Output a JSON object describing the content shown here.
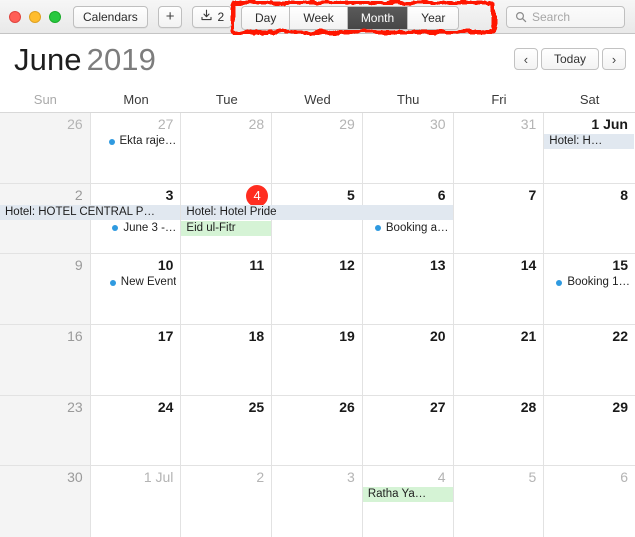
{
  "window": {
    "traffic_lights": [
      "close",
      "minimize",
      "zoom"
    ]
  },
  "toolbar": {
    "calendars_label": "Calendars",
    "add_label": "+",
    "inbox_icon": "download-tray-icon",
    "inbox_count": "2",
    "views": [
      {
        "label": "Day",
        "active": false
      },
      {
        "label": "Week",
        "active": false
      },
      {
        "label": "Month",
        "active": true
      },
      {
        "label": "Year",
        "active": false
      }
    ],
    "search": {
      "icon": "search-icon",
      "placeholder": "Search",
      "value": ""
    },
    "annotation": {
      "color": "#ff1200",
      "target": "view-switcher"
    }
  },
  "header": {
    "month": "June",
    "year": "2019",
    "prev_label": "‹",
    "today_label": "Today",
    "next_label": "›"
  },
  "weekdays": [
    {
      "label": "Sun",
      "muted": true
    },
    {
      "label": "Mon",
      "muted": false
    },
    {
      "label": "Tue",
      "muted": false
    },
    {
      "label": "Wed",
      "muted": false
    },
    {
      "label": "Thu",
      "muted": false
    },
    {
      "label": "Fri",
      "muted": false
    },
    {
      "label": "Sat",
      "muted": false
    }
  ],
  "grid": {
    "weeks": [
      [
        {
          "num": "26",
          "other": true,
          "weekend": true,
          "today": false,
          "bold": false
        },
        {
          "num": "27",
          "other": true,
          "weekend": false,
          "today": false,
          "bold": false
        },
        {
          "num": "28",
          "other": true,
          "weekend": false,
          "today": false,
          "bold": false
        },
        {
          "num": "29",
          "other": true,
          "weekend": false,
          "today": false,
          "bold": false
        },
        {
          "num": "30",
          "other": true,
          "weekend": false,
          "today": false,
          "bold": false
        },
        {
          "num": "31",
          "other": true,
          "weekend": false,
          "today": false,
          "bold": false
        },
        {
          "num": "1 Jun",
          "other": false,
          "weekend": false,
          "today": false,
          "bold": true
        }
      ],
      [
        {
          "num": "2",
          "other": false,
          "weekend": true,
          "today": false,
          "bold": false
        },
        {
          "num": "3",
          "other": false,
          "weekend": false,
          "today": false,
          "bold": true
        },
        {
          "num": "4",
          "other": false,
          "weekend": false,
          "today": true,
          "bold": false
        },
        {
          "num": "5",
          "other": false,
          "weekend": false,
          "today": false,
          "bold": true
        },
        {
          "num": "6",
          "other": false,
          "weekend": false,
          "today": false,
          "bold": true
        },
        {
          "num": "7",
          "other": false,
          "weekend": false,
          "today": false,
          "bold": true
        },
        {
          "num": "8",
          "other": false,
          "weekend": false,
          "today": false,
          "bold": true
        }
      ],
      [
        {
          "num": "9",
          "other": false,
          "weekend": true,
          "today": false,
          "bold": false
        },
        {
          "num": "10",
          "other": false,
          "weekend": false,
          "today": false,
          "bold": true
        },
        {
          "num": "11",
          "other": false,
          "weekend": false,
          "today": false,
          "bold": true
        },
        {
          "num": "12",
          "other": false,
          "weekend": false,
          "today": false,
          "bold": true
        },
        {
          "num": "13",
          "other": false,
          "weekend": false,
          "today": false,
          "bold": true
        },
        {
          "num": "14",
          "other": false,
          "weekend": false,
          "today": false,
          "bold": true
        },
        {
          "num": "15",
          "other": false,
          "weekend": false,
          "today": false,
          "bold": true
        }
      ],
      [
        {
          "num": "16",
          "other": false,
          "weekend": true,
          "today": false,
          "bold": false
        },
        {
          "num": "17",
          "other": false,
          "weekend": false,
          "today": false,
          "bold": true
        },
        {
          "num": "18",
          "other": false,
          "weekend": false,
          "today": false,
          "bold": true
        },
        {
          "num": "19",
          "other": false,
          "weekend": false,
          "today": false,
          "bold": true
        },
        {
          "num": "20",
          "other": false,
          "weekend": false,
          "today": false,
          "bold": true
        },
        {
          "num": "21",
          "other": false,
          "weekend": false,
          "today": false,
          "bold": true
        },
        {
          "num": "22",
          "other": false,
          "weekend": false,
          "today": false,
          "bold": true
        }
      ],
      [
        {
          "num": "23",
          "other": false,
          "weekend": true,
          "today": false,
          "bold": false
        },
        {
          "num": "24",
          "other": false,
          "weekend": false,
          "today": false,
          "bold": true
        },
        {
          "num": "25",
          "other": false,
          "weekend": false,
          "today": false,
          "bold": true
        },
        {
          "num": "26",
          "other": false,
          "weekend": false,
          "today": false,
          "bold": true
        },
        {
          "num": "27",
          "other": false,
          "weekend": false,
          "today": false,
          "bold": true
        },
        {
          "num": "28",
          "other": false,
          "weekend": false,
          "today": false,
          "bold": true
        },
        {
          "num": "29",
          "other": false,
          "weekend": false,
          "today": false,
          "bold": true
        }
      ],
      [
        {
          "num": "30",
          "other": false,
          "weekend": true,
          "today": false,
          "bold": true
        },
        {
          "num": "1 Jul",
          "other": true,
          "weekend": false,
          "today": false,
          "bold": false
        },
        {
          "num": "2",
          "other": true,
          "weekend": false,
          "today": false,
          "bold": false
        },
        {
          "num": "3",
          "other": true,
          "weekend": false,
          "today": false,
          "bold": false
        },
        {
          "num": "4",
          "other": true,
          "weekend": false,
          "today": false,
          "bold": false
        },
        {
          "num": "5",
          "other": true,
          "weekend": false,
          "today": false,
          "bold": false
        },
        {
          "num": "6",
          "other": true,
          "weekend": false,
          "today": false,
          "bold": false
        }
      ]
    ],
    "events": [
      {
        "title": "Ekta raje…",
        "style": "dotted",
        "row": 0,
        "col_start": 1,
        "col_span": 1,
        "slot": 0
      },
      {
        "title": "Hotel: H…",
        "style": "bar-blue",
        "row": 0,
        "col_start": 6,
        "col_span": 1,
        "slot": 0
      },
      {
        "title": "Hotel: HOTEL CENTRAL P…",
        "style": "bar-blue",
        "row": 1,
        "col_start": 0,
        "col_span": 2,
        "slot": 0
      },
      {
        "title": "June 3 -…",
        "style": "dotted",
        "row": 1,
        "col_start": 1,
        "col_span": 1,
        "slot": 1
      },
      {
        "title": "Hotel: Hotel Pride",
        "style": "bar-blue",
        "row": 1,
        "col_start": 2,
        "col_span": 3,
        "slot": 0
      },
      {
        "title": "Eid ul-Fitr",
        "style": "bar-green",
        "row": 1,
        "col_start": 2,
        "col_span": 1,
        "slot": 1
      },
      {
        "title": "Booking a…",
        "style": "dotted",
        "row": 1,
        "col_start": 4,
        "col_span": 1,
        "slot": 1
      },
      {
        "title": "New Event",
        "style": "dotted",
        "row": 2,
        "col_start": 1,
        "col_span": 1,
        "slot": 0
      },
      {
        "title": "Booking 1…",
        "style": "dotted",
        "row": 2,
        "col_start": 6,
        "col_span": 1,
        "slot": 0
      },
      {
        "title": "Ratha Ya…",
        "style": "bar-green",
        "row": 5,
        "col_start": 4,
        "col_span": 1,
        "slot": 0
      }
    ]
  },
  "colors": {
    "today_badge": "#ff2d20",
    "event_dot": "#2f9ae0",
    "bar_blue": "#e1e8f0",
    "bar_green": "#d5f3d5",
    "annotation_red": "#ff1200",
    "weekend_bg": "#f4f4f4"
  }
}
